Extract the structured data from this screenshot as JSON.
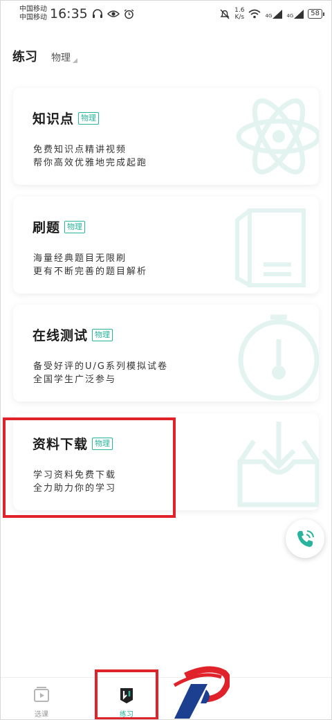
{
  "status_bar": {
    "carrier1": "中国移动",
    "carrier2": "中国移动",
    "time": "16:35",
    "speed_value": "1.6",
    "speed_unit": "K/s",
    "network1": "4G",
    "network2": "4G",
    "battery": "58"
  },
  "header": {
    "title": "练习",
    "subject": "物理"
  },
  "cards": [
    {
      "title": "知识点",
      "tag": "物理",
      "line1": "免费知识点精讲视频",
      "line2": "帮你高效优雅地完成起跑",
      "icon": "atom-icon"
    },
    {
      "title": "刷题",
      "tag": "物理",
      "line1": "海量经典题目无限刷",
      "line2": "更有不断完善的题目解析",
      "icon": "document-icon"
    },
    {
      "title": "在线测试",
      "tag": "物理",
      "line1": "备受好评的U/G系列模拟试卷",
      "line2": "全国学生广泛参与",
      "icon": "stopwatch-icon"
    },
    {
      "title": "资料下载",
      "tag": "物理",
      "line1": "学习资料免费下载",
      "line2": "全力助力你的学习",
      "icon": "download-box-icon"
    }
  ],
  "bottom_nav": {
    "items": [
      {
        "label": "选课",
        "icon": "video-icon"
      },
      {
        "label": "练习",
        "icon": "practice-icon"
      }
    ]
  },
  "colors": {
    "accent": "#27b39c",
    "highlight": "#e0232b"
  }
}
